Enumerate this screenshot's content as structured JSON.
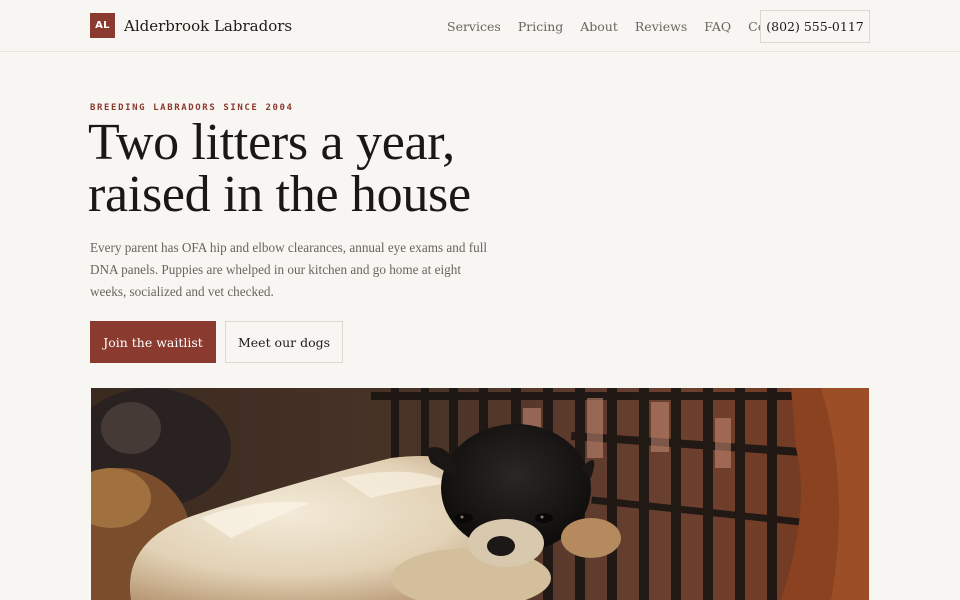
{
  "header": {
    "logo_mark": "AL",
    "brand_name": "Alderbrook Labradors",
    "nav": [
      "Services",
      "Pricing",
      "About",
      "Reviews",
      "FAQ",
      "Contact"
    ],
    "phone": "(802) 555-0117"
  },
  "hero": {
    "eyebrow": "BREEDING LABRADORS SINCE 2004",
    "headline_line1": "Two litters a year,",
    "headline_line2": "raised in the house",
    "intro": "Every parent has OFA hip and elbow clearances, annual eye exams and full DNA panels. Puppies are whelped in our kitchen and go home at eight weeks, socialized and vet checked.",
    "primary_cta": "Join the waitlist",
    "secondary_cta": "Meet our dogs"
  },
  "colors": {
    "accent": "#8b3a2f",
    "background": "#f8f6f2",
    "text": "#1a1714",
    "muted": "#6a645d"
  }
}
